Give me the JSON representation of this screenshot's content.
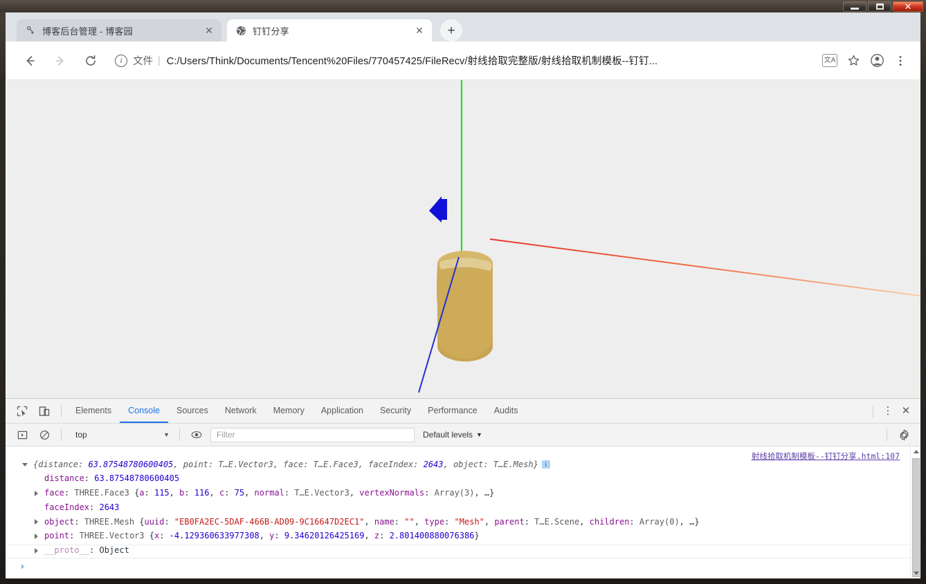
{
  "window": {
    "controls": [
      {
        "name": "minimize",
        "glyph": "—"
      },
      {
        "name": "maximize",
        "glyph": "▢"
      },
      {
        "name": "close",
        "glyph": "✕"
      }
    ]
  },
  "browser": {
    "tabs": [
      {
        "favicon": "bokeyuan-icon",
        "title": "博客后台管理 - 博客园",
        "close": "✕",
        "active": false
      },
      {
        "favicon": "globe-icon",
        "title": "钉钉分享",
        "close": "✕",
        "active": true
      }
    ],
    "new_tab_label": "+",
    "toolbar": {
      "back": "←",
      "forward": "→",
      "reload": "⟳",
      "info_glyph": "i",
      "scheme_label": "文件",
      "scheme_separator": "|",
      "url": "C:/Users/Think/Documents/Tencent%20Files/770457425/FileRecv/射线拾取完整版/射线拾取机制模板--钉钉...",
      "translate_glyph": "文A",
      "bookmark": "☆",
      "profile": "●",
      "menu": "⋮"
    }
  },
  "scene": {
    "background_color": "#eeeeee",
    "mesh_color": "#cdab58",
    "mesh_outline_color": "#e3d4a8",
    "axes": [
      {
        "name": "y-axis-green",
        "color": "#22dd22"
      },
      {
        "name": "x-axis-red",
        "color": "#e8352a",
        "color_far": "#f7c9a0"
      },
      {
        "name": "z-axis-blue",
        "color": "#2030d0"
      }
    ],
    "marker": {
      "name": "blue-arrow-marker",
      "color": "#1010d8"
    }
  },
  "devtools": {
    "tools": {
      "inspect_icon": "inspect-element-icon",
      "device_icon": "toggle-device-toolbar-icon",
      "kebab": "⋮",
      "close": "✕"
    },
    "tabs": [
      {
        "label": "Elements",
        "active": false
      },
      {
        "label": "Console",
        "active": true
      },
      {
        "label": "Sources",
        "active": false
      },
      {
        "label": "Network",
        "active": false
      },
      {
        "label": "Memory",
        "active": false
      },
      {
        "label": "Application",
        "active": false
      },
      {
        "label": "Security",
        "active": false
      },
      {
        "label": "Performance",
        "active": false
      },
      {
        "label": "Audits",
        "active": false
      }
    ],
    "filterbar": {
      "execute_icon": "▶",
      "clear_icon": "🚫",
      "context_value": "top",
      "context_caret": "▼",
      "eye_icon": "◉",
      "filter_placeholder": "Filter",
      "filter_value": "",
      "levels_label": "Default levels",
      "levels_caret": "▼",
      "settings_icon": "⚙"
    },
    "console": {
      "source_link": "射线拾取机制模板--钉钉分享.html:107",
      "prompt": "›",
      "summary": {
        "open_brace": "{",
        "close_brace": "}",
        "parts": [
          {
            "key": "distance",
            "value": "63.87548780600405",
            "kind": "num"
          },
          {
            "key": "point",
            "value": "T…E.Vector3",
            "kind": "cls"
          },
          {
            "key": "face",
            "value": "T…E.Face3",
            "kind": "cls"
          },
          {
            "key": "faceIndex",
            "value": "2643",
            "kind": "num"
          },
          {
            "key": "object",
            "value": "T…E.Mesh",
            "kind": "cls"
          }
        ],
        "info_badge": "i"
      },
      "rows": [
        {
          "name": "distance-row",
          "expandable": false,
          "key": "distance",
          "text": "63.87548780600405"
        },
        {
          "name": "face-row",
          "expandable": true,
          "key": "face",
          "text": "THREE.Face3 {a: 115, b: 116, c: 75, normal: T…E.Vector3, vertexNormals: Array(3), …}"
        },
        {
          "name": "faceindex-row",
          "expandable": false,
          "key": "faceIndex",
          "text": "2643"
        },
        {
          "name": "object-row",
          "expandable": true,
          "key": "object",
          "text": "THREE.Mesh {uuid: \"EB0FA2EC-5DAF-466B-AD09-9C16647D2EC1\", name: \"\", type: \"Mesh\", parent: T…E.Scene, children: Array(0), …}"
        },
        {
          "name": "point-row",
          "expandable": true,
          "key": "point",
          "text": "THREE.Vector3 {x: -4.129360633977308, y: 9.34620126425169, z: 2.801400880076386}"
        },
        {
          "name": "proto-row",
          "expandable": true,
          "key": "__proto__",
          "text": "Object"
        }
      ]
    }
  }
}
